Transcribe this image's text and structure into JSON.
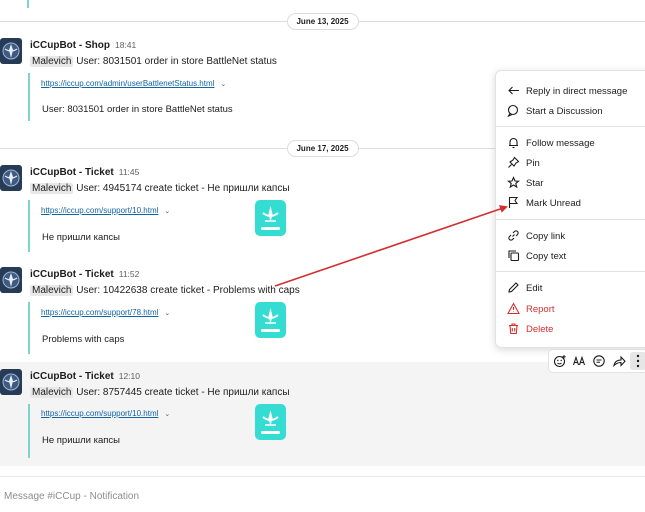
{
  "channel": {
    "composer_placeholder": "Message #iCCup - Notification"
  },
  "dividers": [
    {
      "label": "June 13, 2025"
    },
    {
      "label": "June 17, 2025"
    }
  ],
  "messages": [
    {
      "author": "iCCupBot - Shop",
      "time": "18:41",
      "mention": "Malevich",
      "text": "User: 8031501 order in store BattleNet status",
      "link": "https://iccup.com/admin/userBattlenetStatus.html",
      "attachment_text": "User: 8031501 order in store BattleNet status"
    },
    {
      "author": "iCCupBot - Ticket",
      "time": "11:45",
      "mention": "Malevich",
      "text": "User: 4945174 create ticket - Не пришли капсы",
      "link": "https://iccup.com/support/10.html",
      "attachment_text": "Не пришли капсы"
    },
    {
      "author": "iCCupBot - Ticket",
      "time": "11:52",
      "mention": "Malevich",
      "text": "User: 10422638 create ticket - Problems with caps",
      "link": "https://iccup.com/support/78.html",
      "attachment_text": "Problems with caps"
    },
    {
      "author": "iCCupBot - Ticket",
      "time": "12:10",
      "mention": "Malevich",
      "text": "User: 8757445 create ticket - Не пришли капсы",
      "link": "https://iccup.com/support/10.html",
      "attachment_text": "Не пришли капсы"
    }
  ],
  "context_menu": {
    "items": [
      {
        "label": "Reply in direct message",
        "icon": "reply-arrow-icon"
      },
      {
        "label": "Start a Discussion",
        "icon": "discussion-icon"
      },
      {
        "label": "Follow message",
        "icon": "bell-icon"
      },
      {
        "label": "Pin",
        "icon": "pin-icon"
      },
      {
        "label": "Star",
        "icon": "star-icon"
      },
      {
        "label": "Mark Unread",
        "icon": "flag-icon"
      },
      {
        "label": "Copy link",
        "icon": "link-icon"
      },
      {
        "label": "Copy text",
        "icon": "copy-icon"
      },
      {
        "label": "Edit",
        "icon": "pencil-icon"
      },
      {
        "label": "Report",
        "icon": "warning-icon"
      },
      {
        "label": "Delete",
        "icon": "trash-icon"
      }
    ]
  },
  "message_actions": [
    "add-reaction-icon",
    "translate-icon",
    "reply-in-thread-icon",
    "share-icon",
    "kebab-menu-icon"
  ],
  "colors": {
    "link": "#1264a3",
    "attachment_bar": "#7ed4c8",
    "thumbnail": "#35dcd2",
    "danger": "#d0312d",
    "annotation_arrow": "#d32f2f",
    "avatar": "#273b57"
  }
}
